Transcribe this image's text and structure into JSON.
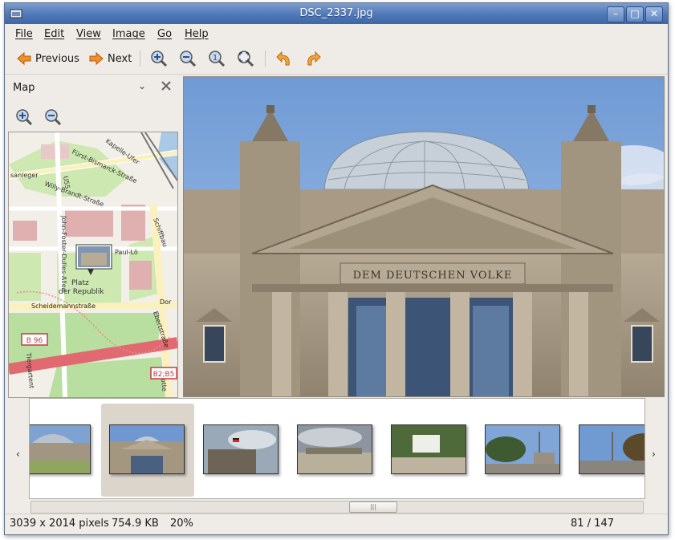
{
  "window": {
    "title": "DSC_2337.jpg"
  },
  "menu": [
    {
      "label": "File"
    },
    {
      "label": "Edit"
    },
    {
      "label": "View"
    },
    {
      "label": "Image"
    },
    {
      "label": "Go"
    },
    {
      "label": "Help"
    }
  ],
  "toolbar": {
    "previous_label": "Previous",
    "next_label": "Next"
  },
  "side_panel": {
    "title": "Map"
  },
  "map": {
    "labels": {
      "kapelle": "Kapelle-Ufer",
      "bismarck": "Fürst-Bismarck-Straße",
      "sanleger": "sanleger",
      "u55": "U55",
      "willy": "Willy-Brandt-Straße",
      "john": "John-Foster-Dulles-Allee",
      "paul": "Paul-Lö",
      "platz1": "Platz",
      "platz2": "der Republik",
      "scheide": "Scheidemannstraße",
      "dor": "Dor",
      "ebert": "Ebertstraße",
      "b96": "B 96",
      "b2b5": "B2;B5",
      "tiergarten": "Tiergartent",
      "otte": "otte",
      "schiffbau": "Schiffbau"
    }
  },
  "image": {
    "inscription": "DEM DEUTSCHEN VOLKE"
  },
  "status": {
    "dimensions": "3039 x 2014 pixels",
    "filesize": "754.9 KB",
    "zoom": "20%",
    "position": "81 / 147"
  },
  "colors": {
    "titlebar": "#4f78b8",
    "window_bg": "#efebe7",
    "sky": "#7fa8dd"
  }
}
